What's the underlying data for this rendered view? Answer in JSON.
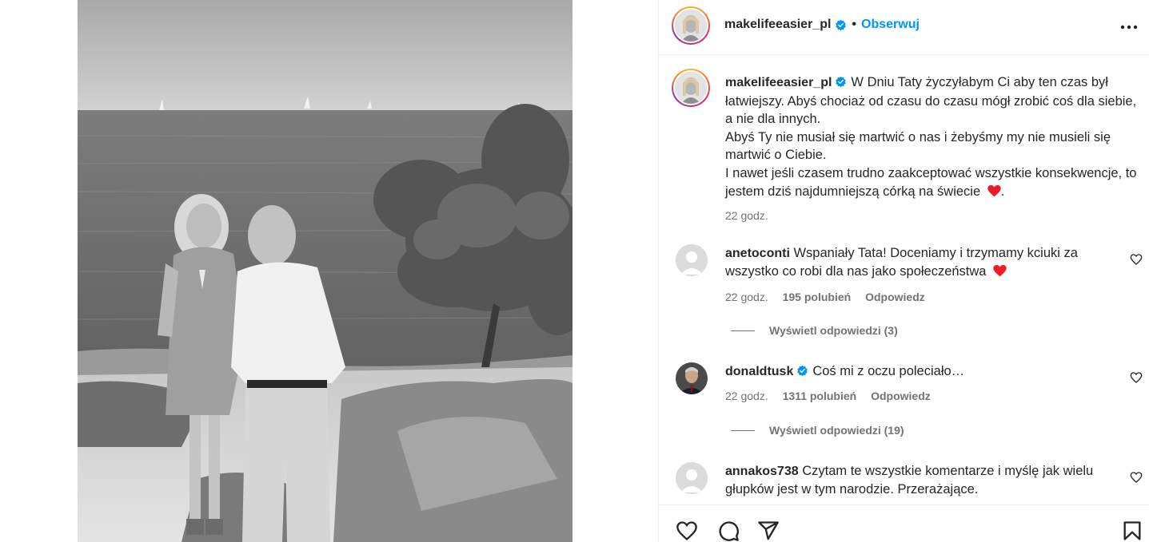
{
  "post": {
    "author": "makelifeeasier_pl",
    "follow_label": "Obserwuj",
    "separator": "•",
    "caption_lines": [
      "W Dniu Taty życzyłabym Ci aby ten czas był łatwiejszy. Abyś chociaż od czasu do czasu mógł zrobić coś dla siebie, a nie dla innych.",
      "Abyś Ty nie musiał się martwić o nas i żebyśmy my nie musieli się martwić o Ciebie.",
      "I nawet jeśli czasem trudno zaakceptować wszystkie konsekwencje, to jestem dziś najdumniejszą córką na świecie"
    ],
    "caption_suffix": ".",
    "time": "22 godz."
  },
  "comments": [
    {
      "username": "anetoconti",
      "text": "Wspaniały Tata! Doceniamy i trzymamy kciuki za wszystko co robi dla nas jako społeczeństwa",
      "heart": true,
      "verified": false,
      "time": "22 godz.",
      "likes": "195 polubień",
      "reply_label": "Odpowiedz",
      "view_replies": "Wyświetl odpowiedzi (3)"
    },
    {
      "username": "donaldtusk",
      "text": "Coś mi z oczu poleciało…",
      "heart": false,
      "verified": true,
      "time": "22 godz.",
      "likes": "1311 polubień",
      "reply_label": "Odpowiedz",
      "view_replies": "Wyświetl odpowiedzi (19)"
    },
    {
      "username": "annakos738",
      "text": "Czytam te wszystkie komentarze i myślę jak wielu głupków jest w tym narodzie. Przerażające.",
      "heart": false,
      "verified": false
    }
  ],
  "icons": {
    "verified": "verified-badge-icon",
    "more": "more-options-icon",
    "like": "heart-icon",
    "comment": "comment-icon",
    "share": "share-icon",
    "save": "bookmark-icon"
  },
  "colors": {
    "accent": "#0095f6",
    "heart_red": "#ed4956",
    "meta_gray": "#737373",
    "text": "#262626"
  }
}
